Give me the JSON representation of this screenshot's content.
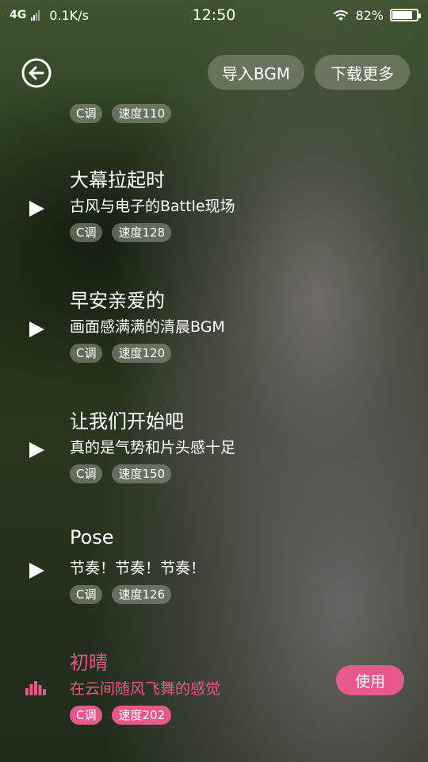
{
  "status_bar": {
    "network": "4G",
    "speed": "0.1K/s",
    "time": "12:50",
    "battery": "82%",
    "battery_level": 0.82
  },
  "header": {
    "back_icon": "back-arrow-circle-icon",
    "import_label": "导入BGM",
    "download_label": "下载更多"
  },
  "partial_item": {
    "key": "C调",
    "speed": "速度110"
  },
  "items": [
    {
      "title": "大幕拉起时",
      "desc": "古风与电子的Battle现场",
      "key": "C调",
      "speed": "速度128",
      "icon": "play-icon"
    },
    {
      "title": "早安亲爱的",
      "desc": "画面感满满的清晨BGM",
      "key": "C调",
      "speed": "速度120",
      "icon": "play-icon"
    },
    {
      "title": "让我们开始吧",
      "desc": "真的是气势和片头感十足",
      "key": "C调",
      "speed": "速度150",
      "icon": "play-icon"
    },
    {
      "title": "Pose",
      "desc": "节奏！节奏！节奏！",
      "key": "C调",
      "speed": "速度126",
      "icon": "play-icon"
    }
  ],
  "active_item": {
    "title": "初晴",
    "desc": "在云间随风飞舞的感觉",
    "key": "C调",
    "speed": "速度202",
    "icon": "equalizer-icon",
    "use_label": "使用"
  },
  "colors": {
    "accent": "#e6598a",
    "tag_bg": "#7f8a76",
    "text": "#ffffff"
  }
}
